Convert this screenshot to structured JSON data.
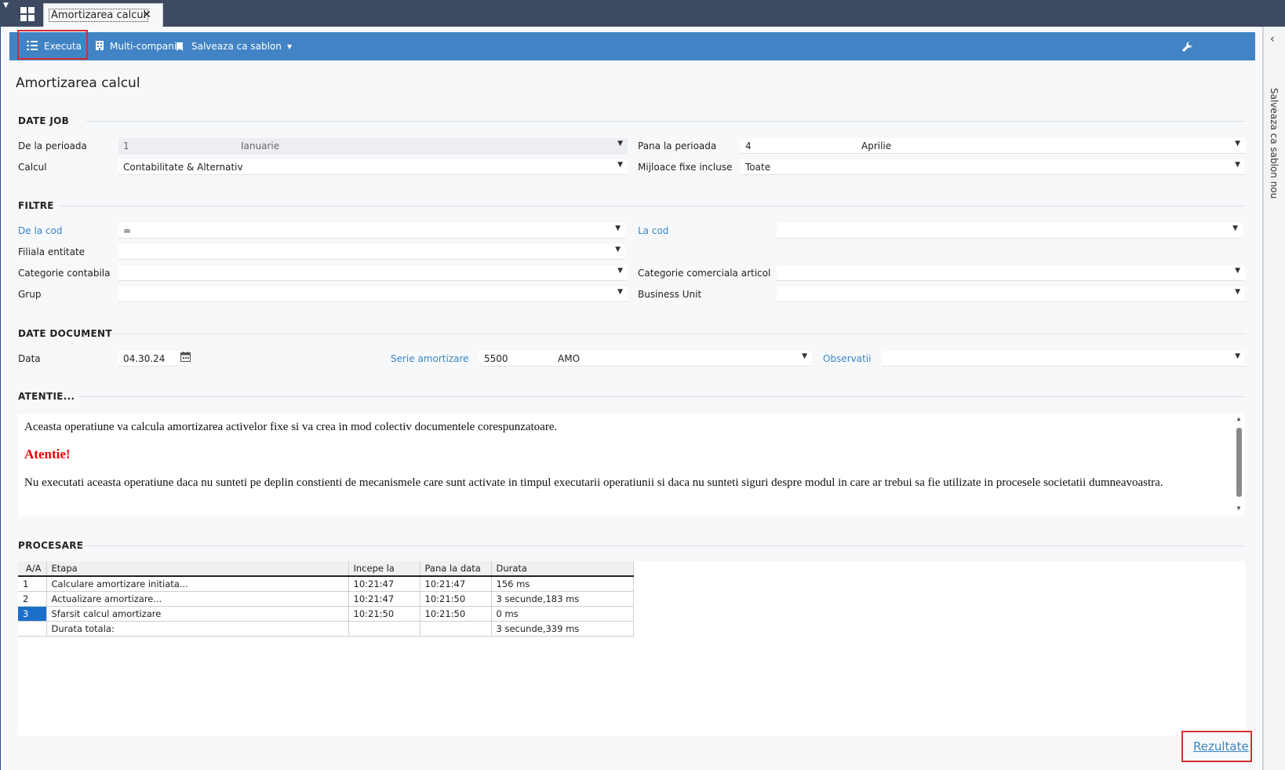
{
  "tabs": [
    {
      "label": "Amortizarea calcul"
    }
  ],
  "toolbar": {
    "execute_label": "Executa",
    "multi_company_label": "Multi-companie",
    "save_template_label": "Salveaza ca sablon no"
  },
  "right_rail": {
    "label": "Salveaza ca sablon nou"
  },
  "page_title": "Amortizarea calcul",
  "sections": {
    "date_job": "DATE JOB",
    "filtre": "FILTRE",
    "date_document": "DATE DOCUMENT",
    "atentie": "ATENTIE...",
    "procesare": "PROCESARE"
  },
  "date_job": {
    "de_la_perioada": {
      "label": "De la perioada",
      "value": "1",
      "name": "Ianuarie"
    },
    "pana_la_perioada": {
      "label": "Pana la perioada",
      "value": "4",
      "name": "Aprilie"
    },
    "calcul": {
      "label": "Calcul",
      "value": "Contabilitate & Alternativ"
    },
    "mijloace": {
      "label": "Mijloace fixe incluse",
      "value": "Toate"
    }
  },
  "filtre": {
    "de_la_cod": {
      "label": "De la cod",
      "value": "="
    },
    "la_cod": {
      "label": "La cod",
      "value": ""
    },
    "filiala": {
      "label": "Filiala entitate",
      "value": ""
    },
    "categorie_contabila": {
      "label": "Categorie contabila",
      "value": ""
    },
    "categorie_comerciala": {
      "label": "Categorie comerciala articol",
      "value": ""
    },
    "grup": {
      "label": "Grup",
      "value": ""
    },
    "business_unit": {
      "label": "Business Unit",
      "value": ""
    }
  },
  "date_document": {
    "data": {
      "label": "Data",
      "value": "04.30.24"
    },
    "serie": {
      "label": "Serie amortizare",
      "value": "5500",
      "name": "AMO"
    },
    "observatii": {
      "label": "Observatii",
      "value": ""
    }
  },
  "attention": {
    "line1": "Aceasta operatiune va calcula amortizarea activelor fixe si va crea in mod colectiv documentele corespunzatoare.",
    "warning": "Atentie!",
    "line2": "Nu executati aceasta operatiune daca nu sunteti pe deplin constienti de mecanismele care sunt activate in timpul executarii operatiunii si daca nu sunteti siguri despre modul in care ar trebui sa fie utilizate in procesele societatii dumneavoastra."
  },
  "processing": {
    "columns": [
      "A/A",
      "Etapa",
      "Incepe la",
      "Pana la data",
      "Durata"
    ],
    "rows": [
      [
        "1",
        "Calculare amortizare initiata...",
        "10:21:47",
        "10:21:47",
        "156 ms"
      ],
      [
        "2",
        "Actualizare amortizare...",
        "10:21:47",
        "10:21:50",
        "3 secunde,183 ms"
      ],
      [
        "3",
        "Sfarsit calcul amortizare",
        "10:21:50",
        "10:21:50",
        "0 ms"
      ],
      [
        "",
        "Durata totala:",
        "",
        "",
        "3 secunde,339 ms"
      ]
    ]
  },
  "results_link": "Rezultate",
  "colors": {
    "toolbar": "#4183c4",
    "topbar": "#3e4a61",
    "link": "#3a86c8",
    "warning": "#e00000",
    "highlight": "#d32f2f"
  }
}
